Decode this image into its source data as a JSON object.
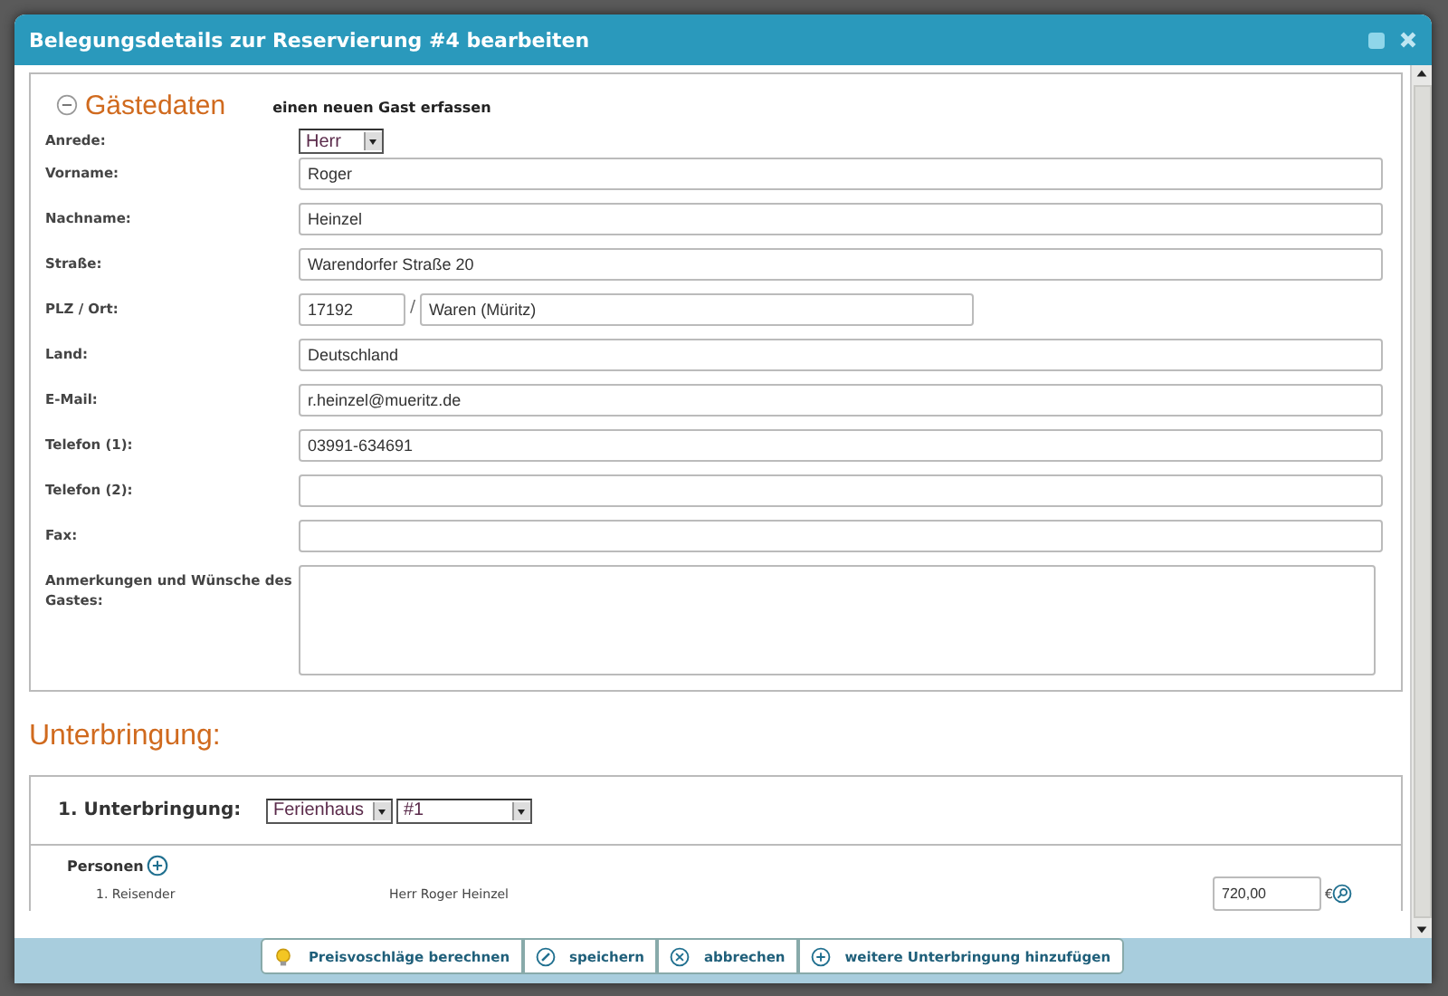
{
  "window": {
    "title": "Belegungsdetails zur Reservierung #4 bearbeiten"
  },
  "guest": {
    "title": "Gästedaten",
    "expanded": true,
    "link": "einen neuen Gast erfassen",
    "fields": [
      {
        "kind": "select",
        "label": "Anrede:",
        "value": "Herr"
      },
      {
        "kind": "text",
        "label": "Vorname:",
        "value": "Roger"
      },
      {
        "kind": "text",
        "label": "Nachname:",
        "value": "Heinzel"
      },
      {
        "kind": "text",
        "label": "Straße:",
        "value": "Warendorfer Straße 20"
      },
      {
        "kind": "plz",
        "label": "PLZ / Ort:",
        "value": "17192",
        "separator": "/",
        "value2": "Waren (Müritz)"
      },
      {
        "kind": "text",
        "label": "Land:",
        "value": "Deutschland"
      },
      {
        "kind": "text",
        "label": "E-Mail:",
        "value": "r.heinzel@mueritz.de"
      },
      {
        "kind": "text",
        "label": "Telefon (1):",
        "value": "03991-634691"
      },
      {
        "kind": "text",
        "label": "Telefon (2):"
      },
      {
        "kind": "text",
        "label": "Fax:"
      },
      {
        "kind": "textarea",
        "label": "Anmerkungen und Wünsche des Gastes:"
      }
    ]
  },
  "accommodation": {
    "title": "Unterbringung:",
    "label": "1. Unterbringung:",
    "type": "Ferienhaus",
    "number": "#1",
    "persons_title": "Personen",
    "persons": [
      {
        "role": "1. Reisender",
        "name": "Herr Roger Heinzel"
      }
    ],
    "price": "720,00",
    "currency": "€"
  },
  "buttons": [
    {
      "kind": "bulb",
      "label": "Preisvoschläge berechnen"
    },
    {
      "kind": "edit",
      "label": "speichern"
    },
    {
      "kind": "cancel",
      "label": "abbrechen"
    },
    {
      "kind": "add",
      "label": "weitere Unterbringung hinzufügen"
    }
  ]
}
